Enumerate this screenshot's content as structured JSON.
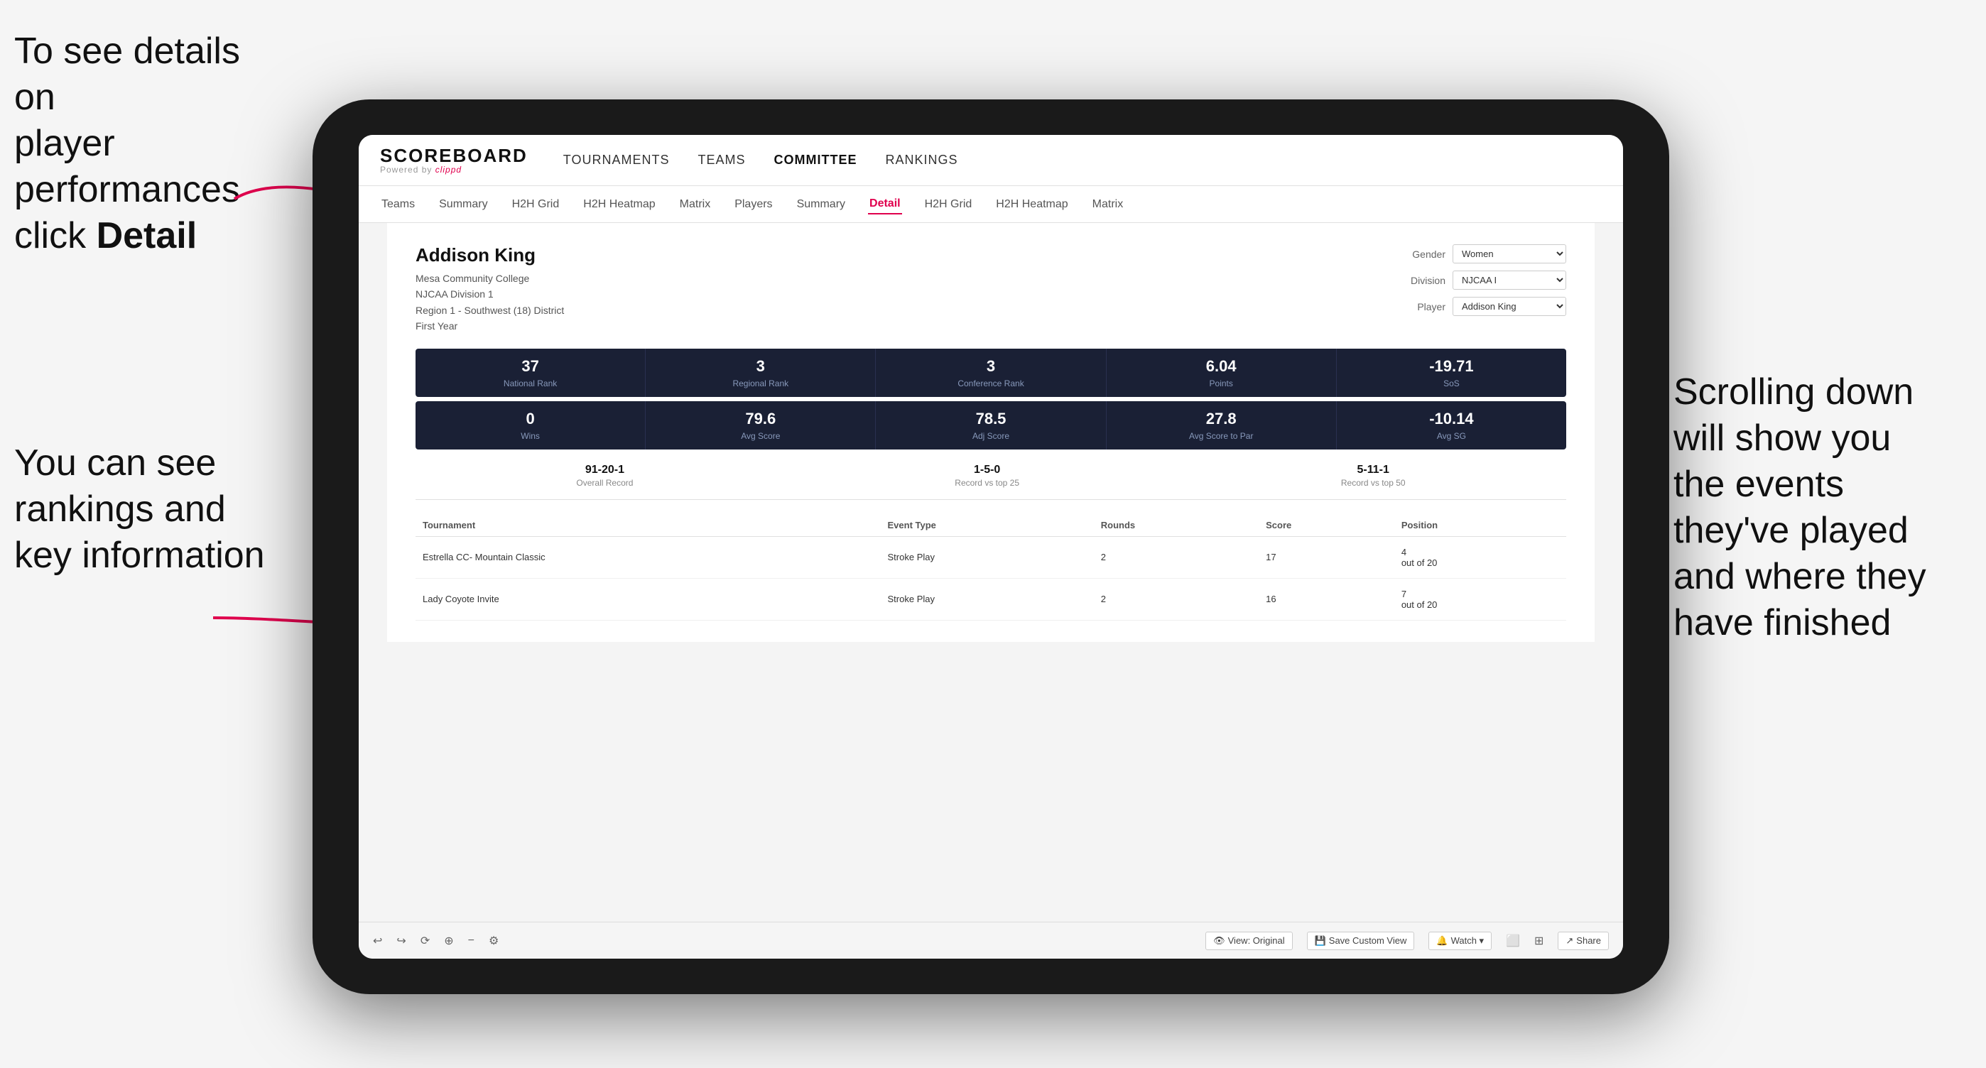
{
  "annotations": {
    "top_left": {
      "line1": "To see details on",
      "line2": "player performances",
      "line3_prefix": "click ",
      "line3_bold": "Detail"
    },
    "bottom_left": {
      "line1": "You can see",
      "line2": "rankings and",
      "line3": "key information"
    },
    "right": {
      "line1": "Scrolling down",
      "line2": "will show you",
      "line3": "the events",
      "line4": "they've played",
      "line5": "and where they",
      "line6": "have finished"
    }
  },
  "nav": {
    "logo": "SCOREBOARD",
    "logo_sub": "Powered by clippd",
    "items": [
      "TOURNAMENTS",
      "TEAMS",
      "COMMITTEE",
      "RANKINGS"
    ]
  },
  "subnav": {
    "items": [
      "Teams",
      "Summary",
      "H2H Grid",
      "H2H Heatmap",
      "Matrix",
      "Players",
      "Summary",
      "Detail",
      "H2H Grid",
      "H2H Heatmap",
      "Matrix"
    ],
    "active": "Detail"
  },
  "player": {
    "name": "Addison King",
    "school": "Mesa Community College",
    "division": "NJCAA Division 1",
    "region": "Region 1 - Southwest (18) District",
    "year": "First Year"
  },
  "filters": {
    "gender_label": "Gender",
    "gender_value": "Women",
    "division_label": "Division",
    "division_value": "NJCAA I",
    "player_label": "Player",
    "player_value": "Addison King"
  },
  "stats_row1": [
    {
      "value": "37",
      "label": "National Rank"
    },
    {
      "value": "3",
      "label": "Regional Rank"
    },
    {
      "value": "3",
      "label": "Conference Rank"
    },
    {
      "value": "6.04",
      "label": "Points"
    },
    {
      "value": "-19.71",
      "label": "SoS"
    }
  ],
  "stats_row2": [
    {
      "value": "0",
      "label": "Wins"
    },
    {
      "value": "79.6",
      "label": "Avg Score"
    },
    {
      "value": "78.5",
      "label": "Adj Score"
    },
    {
      "value": "27.8",
      "label": "Avg Score to Par"
    },
    {
      "value": "-10.14",
      "label": "Avg SG"
    }
  ],
  "records": [
    {
      "value": "91-20-1",
      "label": "Overall Record"
    },
    {
      "value": "1-5-0",
      "label": "Record vs top 25"
    },
    {
      "value": "5-11-1",
      "label": "Record vs top 50"
    }
  ],
  "table": {
    "headers": [
      "Tournament",
      "Event Type",
      "Rounds",
      "Score",
      "Position"
    ],
    "rows": [
      {
        "tournament": "Estrella CC- Mountain Classic",
        "event_type": "Stroke Play",
        "rounds": "2",
        "score": "17",
        "position": "4 out of 20"
      },
      {
        "tournament": "Lady Coyote Invite",
        "event_type": "Stroke Play",
        "rounds": "2",
        "score": "16",
        "position": "7 out of 20"
      }
    ]
  },
  "toolbar": {
    "buttons": [
      "View: Original",
      "Save Custom View",
      "Watch",
      "Share"
    ]
  }
}
